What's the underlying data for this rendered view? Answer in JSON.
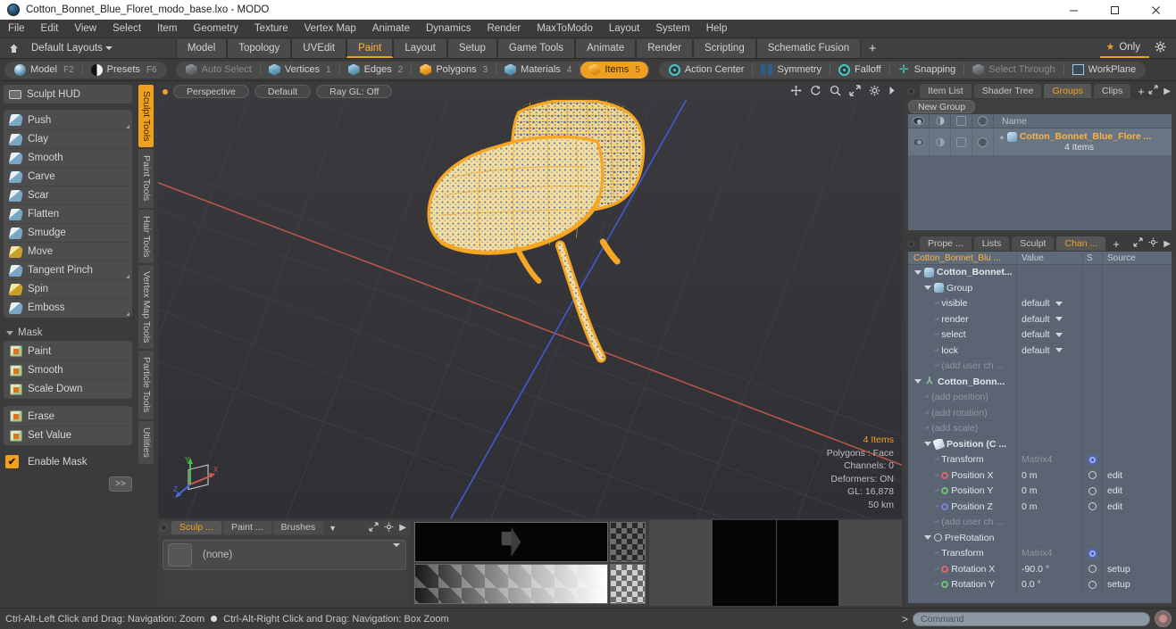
{
  "window": {
    "title": "Cotton_Bonnet_Blue_Floret_modo_base.lxo - MODO",
    "app_icon": "modo-sphere-icon",
    "minimize": "minimize-button",
    "maximize": "maximize-button",
    "close": "close-button"
  },
  "menubar": {
    "items": [
      "File",
      "Edit",
      "View",
      "Select",
      "Item",
      "Geometry",
      "Texture",
      "Vertex Map",
      "Animate",
      "Dynamics",
      "Render",
      "MaxToModo",
      "Layout",
      "System",
      "Help"
    ]
  },
  "layoutbar": {
    "home_icon": "home-icon",
    "dropdown_label": "Default Layouts",
    "tabs": [
      {
        "label": "Model",
        "active": false
      },
      {
        "label": "Topology",
        "active": false
      },
      {
        "label": "UVEdit",
        "active": false
      },
      {
        "label": "Paint",
        "active": true
      },
      {
        "label": "Layout",
        "active": false
      },
      {
        "label": "Setup",
        "active": false
      },
      {
        "label": "Game Tools",
        "active": false
      },
      {
        "label": "Animate",
        "active": false
      },
      {
        "label": "Render",
        "active": false
      },
      {
        "label": "Scripting",
        "active": false
      },
      {
        "label": "Schematic Fusion",
        "active": false
      }
    ],
    "add_label": "+",
    "only_label": "Only",
    "gear_icon": "gear-icon"
  },
  "modebar": {
    "left_group": [
      {
        "label": "Model",
        "hotkey": "F2",
        "icon": "sphere-icon",
        "active": false
      },
      {
        "label": "Presets",
        "hotkey": "F6",
        "icon": "half-sphere-icon",
        "active": false
      }
    ],
    "select_group": [
      {
        "label": "Auto Select",
        "hotkey": "",
        "icon": "cube-gray-icon",
        "active": false,
        "disabled": true
      },
      {
        "label": "Vertices",
        "hotkey": "1",
        "icon": "cube-icon",
        "active": false
      },
      {
        "label": "Edges",
        "hotkey": "2",
        "icon": "cube-icon",
        "active": false
      },
      {
        "label": "Polygons",
        "hotkey": "3",
        "icon": "cube-orange-icon",
        "active": false
      },
      {
        "label": "Materials",
        "hotkey": "4",
        "icon": "cube-icon",
        "active": false
      },
      {
        "label": "Items",
        "hotkey": "5",
        "icon": "cube-orange-icon",
        "active": true
      }
    ],
    "right_group": [
      {
        "label": "Action Center",
        "icon": "action-center-icon",
        "disabled": false
      },
      {
        "label": "Symmetry",
        "icon": "symmetry-icon",
        "disabled": false
      },
      {
        "label": "Falloff",
        "icon": "falloff-icon",
        "disabled": false
      },
      {
        "label": "Snapping",
        "icon": "snapping-icon",
        "disabled": false
      },
      {
        "label": "Select Through",
        "icon": "select-through-icon",
        "disabled": true
      },
      {
        "label": "WorkPlane",
        "icon": "workplane-icon",
        "disabled": false
      }
    ]
  },
  "left_panel": {
    "hud_button": {
      "label": "Sculpt HUD",
      "icon": "hud-icon"
    },
    "sculpt_tools": [
      {
        "label": "Push",
        "icon": "brush-icon",
        "has_corner": true
      },
      {
        "label": "Clay",
        "icon": "brush-icon",
        "has_corner": false
      },
      {
        "label": "Smooth",
        "icon": "brush-icon",
        "has_corner": false
      },
      {
        "label": "Carve",
        "icon": "brush-icon",
        "has_corner": false
      },
      {
        "label": "Scar",
        "icon": "brush-icon",
        "has_corner": false
      },
      {
        "label": "Flatten",
        "icon": "brush-icon",
        "has_corner": false
      },
      {
        "label": "Smudge",
        "icon": "brush-icon",
        "has_corner": false
      },
      {
        "label": "Move",
        "icon": "brush-yellow-icon",
        "has_corner": false
      },
      {
        "label": "Tangent Pinch",
        "icon": "brush-icon",
        "has_corner": true
      },
      {
        "label": "Spin",
        "icon": "brush-yellow-icon",
        "has_corner": false
      },
      {
        "label": "Emboss",
        "icon": "brush-icon",
        "has_corner": true
      }
    ],
    "mask_header": "Mask",
    "mask_tools": [
      {
        "label": "Paint",
        "icon": "mask-icon"
      },
      {
        "label": "Smooth",
        "icon": "mask-icon"
      },
      {
        "label": "Scale Down",
        "icon": "mask-icon"
      }
    ],
    "mask_tools2": [
      {
        "label": "Erase",
        "icon": "mask-icon"
      },
      {
        "label": "Set Value",
        "icon": "mask-icon"
      }
    ],
    "enable_mask": {
      "label": "Enable Mask",
      "checked": true
    },
    "expand_label": ">>",
    "vtabs": [
      {
        "label": "Sculpt Tools",
        "active": true
      },
      {
        "label": "Paint Tools",
        "active": false
      },
      {
        "label": "Hair Tools",
        "active": false
      },
      {
        "label": "Vertex Map Tools",
        "active": false
      },
      {
        "label": "Particle Tools",
        "active": false
      },
      {
        "label": "Utilities",
        "active": false
      }
    ]
  },
  "viewport": {
    "pills": [
      "Perspective",
      "Default",
      "Ray GL: Off"
    ],
    "tool_icons": [
      "pan-icon",
      "rotate-icon",
      "zoom-icon",
      "fit-icon",
      "gear-icon",
      "chevron-right-icon"
    ],
    "info": {
      "items": "4 Items",
      "polygons": "Polygons : Face",
      "channels": "Channels: 0",
      "deformers": "Deformers: ON",
      "gl": "GL: 16,878",
      "scale": "50 km"
    },
    "gizmo": {
      "x": "X",
      "y": "Y",
      "z": "Z"
    }
  },
  "bottom_panel": {
    "tabs": [
      {
        "label": "Sculp ...",
        "active": true
      },
      {
        "label": "Paint ...",
        "active": false
      },
      {
        "label": "Brushes",
        "active": false
      }
    ],
    "dropdown_icon": "chevron-down-icon",
    "expand_icon": "expand-icon",
    "gear_icon": "gear-icon",
    "more_icon": "chevron-right-icon",
    "preset_value": "(none)"
  },
  "right_panel": {
    "top": {
      "tabs": [
        {
          "label": "Item List",
          "active": false
        },
        {
          "label": "Shader Tree",
          "active": false
        },
        {
          "label": "Groups",
          "active": true
        },
        {
          "label": "Clips",
          "active": false
        }
      ],
      "add_label": "+",
      "expand_icon": "expand-icon",
      "more_icon": "chevron-right-icon",
      "new_group_label": "New Group",
      "column_headers": [
        "visibility-icon",
        "render-icon",
        "lock-icon",
        "select-icon",
        "Name"
      ],
      "rows": [
        {
          "name": "Cotton_Bonnet_Blue_Flore ...",
          "sub": "4 Items"
        }
      ]
    },
    "bottom": {
      "tabs": [
        {
          "label": "Prope ...",
          "active": false
        },
        {
          "label": "Lists",
          "active": false
        },
        {
          "label": "Sculpt",
          "active": false
        },
        {
          "label": "Chan ...",
          "active": true
        }
      ],
      "add_label": "+",
      "expand_icon": "expand-icon",
      "gear_icon": "gear-icon",
      "more_icon": "chevron-right-icon",
      "columns": [
        "Cotton_Bonnet_Blu ...",
        "Value",
        "S",
        "Source"
      ],
      "rows": [
        {
          "indent": 0,
          "tri": "down",
          "icon": "cube-icon",
          "label": "Cotton_Bonnet...",
          "value": "",
          "s": "",
          "source": "",
          "bold": true
        },
        {
          "indent": 1,
          "tri": "down",
          "icon": "cube-icon",
          "label": "Group",
          "value": "",
          "s": "",
          "source": "",
          "bold": false
        },
        {
          "indent": 2,
          "tri": "dash",
          "icon": "",
          "label": "visible",
          "value": "default",
          "s": "",
          "source": "",
          "dropdown": true
        },
        {
          "indent": 2,
          "tri": "dash",
          "icon": "",
          "label": "render",
          "value": "default",
          "s": "",
          "source": "",
          "dropdown": true
        },
        {
          "indent": 2,
          "tri": "dash",
          "icon": "",
          "label": "select",
          "value": "default",
          "s": "",
          "source": "",
          "dropdown": true
        },
        {
          "indent": 2,
          "tri": "dash",
          "icon": "",
          "label": "lock",
          "value": "default",
          "s": "",
          "source": "",
          "dropdown": true
        },
        {
          "indent": 2,
          "tri": "dash",
          "icon": "",
          "label": "(add user ch ...",
          "value": "",
          "s": "",
          "source": "",
          "dim": true
        },
        {
          "indent": 0,
          "tri": "down",
          "icon": "axis-icon",
          "label": "Cotton_Bonn...",
          "value": "",
          "s": "",
          "source": "",
          "bold": true
        },
        {
          "indent": 1,
          "tri": "dash",
          "icon": "",
          "label": "(add position)",
          "value": "",
          "s": "",
          "source": "",
          "dim": true
        },
        {
          "indent": 1,
          "tri": "dash",
          "icon": "",
          "label": "(add rotation)",
          "value": "",
          "s": "",
          "source": "",
          "dim": true
        },
        {
          "indent": 1,
          "tri": "dash",
          "icon": "",
          "label": "(add scale)",
          "value": "",
          "s": "",
          "source": "",
          "dim": true
        },
        {
          "indent": 1,
          "tri": "down",
          "icon": "loc-icon",
          "label": "Position (C ...",
          "value": "",
          "s": "",
          "source": "",
          "bold": true
        },
        {
          "indent": 2,
          "tri": "dash",
          "icon": "",
          "label": "Transform",
          "value": "Matrix4",
          "s": "blue-radio",
          "source": "",
          "dimvalue": true
        },
        {
          "indent": 2,
          "tri": "dash",
          "icon": "dot-red",
          "label": "Position X",
          "value": "0 m",
          "s": "radio",
          "source": "edit"
        },
        {
          "indent": 2,
          "tri": "dash",
          "icon": "dot-green",
          "label": "Position Y",
          "value": "0 m",
          "s": "radio",
          "source": "edit"
        },
        {
          "indent": 2,
          "tri": "dash",
          "icon": "dot-blue",
          "label": "Position Z",
          "value": "0 m",
          "s": "radio",
          "source": "edit"
        },
        {
          "indent": 2,
          "tri": "dash",
          "icon": "",
          "label": "(add user ch ...",
          "value": "",
          "s": "",
          "source": "",
          "dim": true
        },
        {
          "indent": 1,
          "tri": "down",
          "icon": "rot-icon",
          "label": "PreRotation",
          "value": "",
          "s": "",
          "source": "",
          "bold": false
        },
        {
          "indent": 2,
          "tri": "dash",
          "icon": "",
          "label": "Transform",
          "value": "Matrix4",
          "s": "blue-radio",
          "source": "",
          "dimvalue": true
        },
        {
          "indent": 2,
          "tri": "dash",
          "icon": "dot-red",
          "label": "Rotation X",
          "value": "-90.0 °",
          "s": "radio",
          "source": "setup"
        },
        {
          "indent": 2,
          "tri": "dash",
          "icon": "dot-green",
          "label": "Rotation Y",
          "value": "0.0 °",
          "s": "radio",
          "source": "setup"
        }
      ]
    }
  },
  "statusbar": {
    "hint_left": "Ctrl-Alt-Left Click and Drag: Navigation: Zoom",
    "hint_right": "Ctrl-Alt-Right Click and Drag: Navigation: Box Zoom",
    "command_prompt": ">",
    "command_placeholder": "Command",
    "record_icon": "record-button"
  },
  "colors": {
    "accent": "#f0a020",
    "panel": "#3b3b3b",
    "panel_alt": "#4a4a4a",
    "table_blue": "#5a6472",
    "model_orange": "#f5a623",
    "axis_x": "#b5544a",
    "axis_z": "#3f5bd0"
  }
}
